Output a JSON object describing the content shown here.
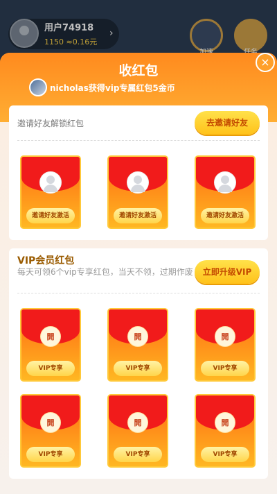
{
  "background": {
    "username": "用户74918",
    "coins": "1150",
    "coins_extra": "≈0.16元",
    "chevron": "›",
    "btn1_label": "加速",
    "btn2_label": "任务"
  },
  "modal": {
    "title": "收红包",
    "close_icon": "×",
    "notice": "nicholas获得vip专属红包5金币"
  },
  "invite_section": {
    "label": "邀请好友解锁红包",
    "button": "去邀请好友",
    "envelopes": [
      {
        "button": "邀请好友激活"
      },
      {
        "button": "邀请好友激活"
      },
      {
        "button": "邀请好友激活"
      }
    ]
  },
  "vip_section": {
    "title": "VIP会员红包",
    "description": "每天可领6个vip专享红包，当天不领，过期作废",
    "button": "立即升级VIP",
    "envelopes": [
      {
        "open": "開",
        "button": "VIP专享"
      },
      {
        "open": "開",
        "button": "VIP专享"
      },
      {
        "open": "開",
        "button": "VIP专享"
      },
      {
        "open": "開",
        "button": "VIP专享"
      },
      {
        "open": "開",
        "button": "VIP专享"
      },
      {
        "open": "開",
        "button": "VIP专享"
      }
    ]
  },
  "colors": {
    "header_orange": "#ff8a1e",
    "button_yellow": "#ffc21a",
    "envelope_red": "#f11b1b",
    "vip_title": "#9a5b00"
  }
}
